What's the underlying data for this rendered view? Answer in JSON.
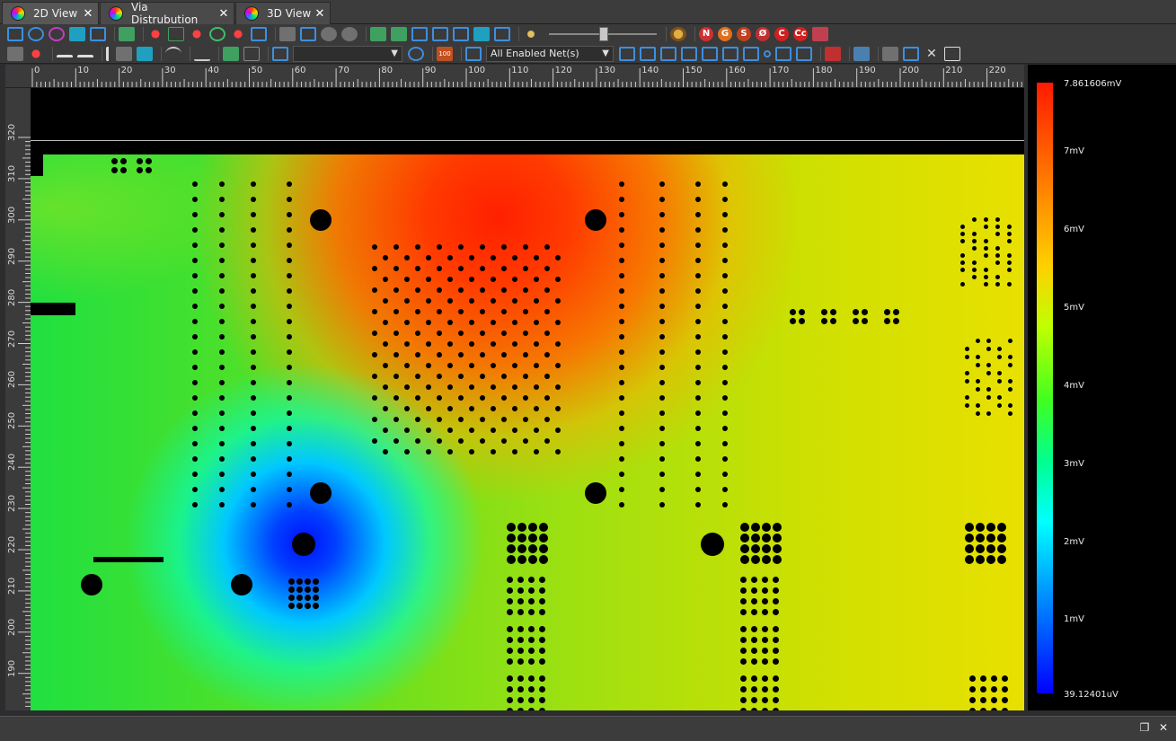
{
  "tabs": [
    {
      "label": "2D View",
      "close": "✕",
      "active": true
    },
    {
      "label": "Via Distrubution",
      "close": "✕",
      "active": false
    },
    {
      "label": "3D View",
      "close": "✕",
      "active": false
    }
  ],
  "toolbar2": {
    "layer_dropdown_value": "",
    "net_dropdown_value": "All Enabled Net(s)",
    "zoom_box_label": "100"
  },
  "toolbar1": {
    "letter_icons": [
      {
        "letter": "N",
        "color": "#d03030"
      },
      {
        "letter": "G",
        "color": "#e07020"
      },
      {
        "letter": "S",
        "color": "#c04020"
      },
      {
        "letter": "Ø",
        "color": "#c03030"
      },
      {
        "letter": "C",
        "color": "#d02020"
      },
      {
        "letter": "Cc",
        "color": "#d02020"
      }
    ]
  },
  "hruler": {
    "ticks": [
      "0",
      "10",
      "20",
      "30",
      "40",
      "50",
      "60",
      "70",
      "80",
      "90",
      "100",
      "110",
      "120",
      "130",
      "140",
      "150",
      "160",
      "170",
      "180",
      "190",
      "200",
      "210",
      "220"
    ]
  },
  "vruler": {
    "ticks": [
      "320",
      "310",
      "300",
      "290",
      "280",
      "270",
      "260",
      "250",
      "240",
      "230",
      "220",
      "210",
      "200",
      "190"
    ]
  },
  "legend": {
    "max": "7.861606mV",
    "labels": [
      "7mV",
      "6mV",
      "5mV",
      "4mV",
      "3mV",
      "2mV",
      "1mV"
    ],
    "min": "39.12401uV",
    "colors": {
      "high": "#ff1a00",
      "mid": "#40ff20",
      "low": "#0000ff"
    }
  },
  "statusbar": {
    "restore": "❐",
    "close": "✕"
  }
}
